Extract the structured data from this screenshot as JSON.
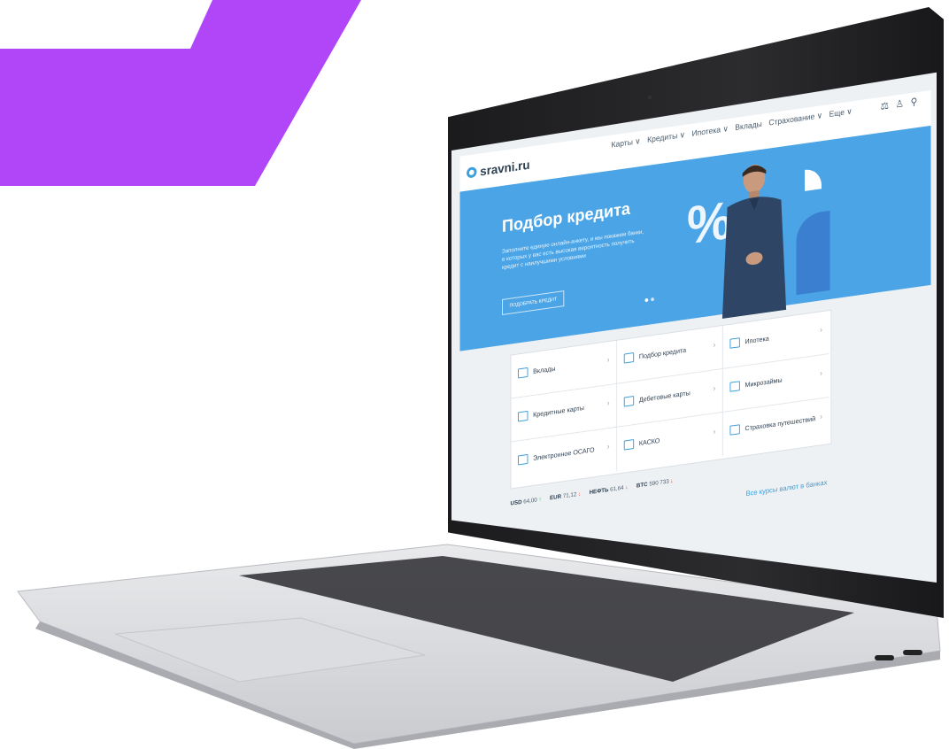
{
  "brand": {
    "name": "sravni.ru",
    "accent": "#4aa4e6",
    "purple": "#b046f7"
  },
  "nav": {
    "items": [
      "Карты ∨",
      "Кредиты ∨",
      "Ипотека ∨",
      "Вклады",
      "Страхование ∨",
      "Еще ∨"
    ],
    "tools": [
      "compare-icon",
      "user-icon",
      "search-icon"
    ]
  },
  "hero": {
    "title": "Подбор кредита",
    "text": "Заполните единую онлайн-анкету, и мы покажем банки, в которых у вас есть высокая вероятность получить кредит с наилучшими условиями",
    "button": "ПОДОБРАТЬ КРЕДИТ",
    "slides": 2,
    "active_slide": 1
  },
  "products": [
    {
      "label": "Вклады",
      "icon": "deposit-icon"
    },
    {
      "label": "Подбор кредита",
      "icon": "credit-icon"
    },
    {
      "label": "Ипотека",
      "icon": "mortgage-icon"
    },
    {
      "label": "Кредитные карты",
      "icon": "credit-card-icon"
    },
    {
      "label": "Дебетовые карты",
      "icon": "debit-card-icon"
    },
    {
      "label": "Микрозаймы",
      "icon": "microloan-icon"
    },
    {
      "label": "Электронное ОСАГО",
      "icon": "document-icon"
    },
    {
      "label": "КАСКО",
      "icon": "car-icon"
    },
    {
      "label": "Страховка путешествий",
      "icon": "travel-icon"
    }
  ],
  "rates": [
    {
      "name": "USD",
      "value": "64,00",
      "dir": "↑"
    },
    {
      "name": "EUR",
      "value": "71,12",
      "dir": "↓"
    },
    {
      "name": "НЕФТЬ",
      "value": "61,64",
      "dir": "↓"
    },
    {
      "name": "BTC",
      "value": "590 733",
      "dir": "↓"
    }
  ],
  "all_rates_link": "Все курсы валют в банках",
  "chevron": "›"
}
